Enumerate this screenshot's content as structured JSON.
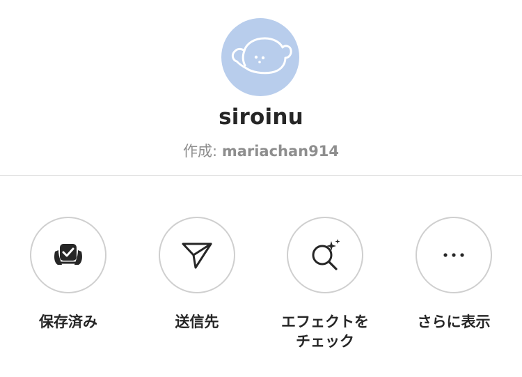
{
  "profile": {
    "effect_name": "siroinu",
    "creator_prefix": "作成: ",
    "creator_name": "mariachan914",
    "avatar_color": "#b8cdec"
  },
  "actions": [
    {
      "label": "保存済み",
      "icon": "saved-check-icon"
    },
    {
      "label": "送信先",
      "icon": "paper-plane-icon"
    },
    {
      "label": "エフェクトを\nチェック",
      "icon": "search-sparkle-icon"
    },
    {
      "label": "さらに表示",
      "icon": "more-dots-icon"
    }
  ]
}
